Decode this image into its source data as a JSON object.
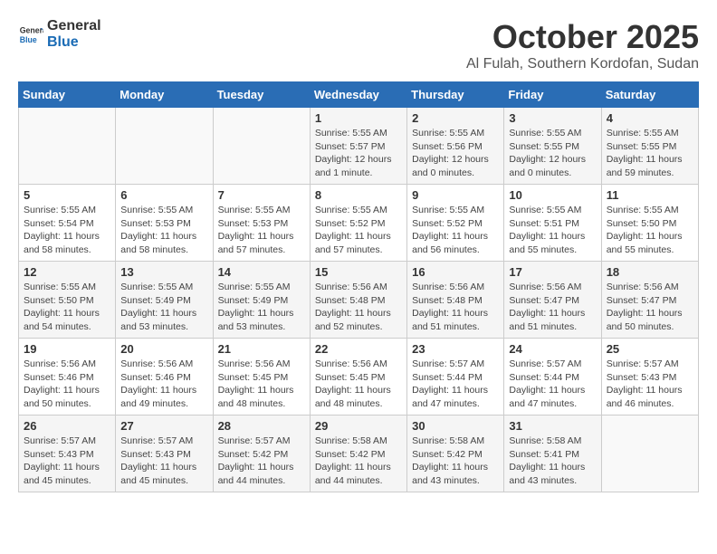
{
  "logo": {
    "general": "General",
    "blue": "Blue"
  },
  "title": "October 2025",
  "location": "Al Fulah, Southern Kordofan, Sudan",
  "weekdays": [
    "Sunday",
    "Monday",
    "Tuesday",
    "Wednesday",
    "Thursday",
    "Friday",
    "Saturday"
  ],
  "weeks": [
    [
      {
        "day": "",
        "info": ""
      },
      {
        "day": "",
        "info": ""
      },
      {
        "day": "",
        "info": ""
      },
      {
        "day": "1",
        "info": "Sunrise: 5:55 AM\nSunset: 5:57 PM\nDaylight: 12 hours\nand 1 minute."
      },
      {
        "day": "2",
        "info": "Sunrise: 5:55 AM\nSunset: 5:56 PM\nDaylight: 12 hours\nand 0 minutes."
      },
      {
        "day": "3",
        "info": "Sunrise: 5:55 AM\nSunset: 5:55 PM\nDaylight: 12 hours\nand 0 minutes."
      },
      {
        "day": "4",
        "info": "Sunrise: 5:55 AM\nSunset: 5:55 PM\nDaylight: 11 hours\nand 59 minutes."
      }
    ],
    [
      {
        "day": "5",
        "info": "Sunrise: 5:55 AM\nSunset: 5:54 PM\nDaylight: 11 hours\nand 58 minutes."
      },
      {
        "day": "6",
        "info": "Sunrise: 5:55 AM\nSunset: 5:53 PM\nDaylight: 11 hours\nand 58 minutes."
      },
      {
        "day": "7",
        "info": "Sunrise: 5:55 AM\nSunset: 5:53 PM\nDaylight: 11 hours\nand 57 minutes."
      },
      {
        "day": "8",
        "info": "Sunrise: 5:55 AM\nSunset: 5:52 PM\nDaylight: 11 hours\nand 57 minutes."
      },
      {
        "day": "9",
        "info": "Sunrise: 5:55 AM\nSunset: 5:52 PM\nDaylight: 11 hours\nand 56 minutes."
      },
      {
        "day": "10",
        "info": "Sunrise: 5:55 AM\nSunset: 5:51 PM\nDaylight: 11 hours\nand 55 minutes."
      },
      {
        "day": "11",
        "info": "Sunrise: 5:55 AM\nSunset: 5:50 PM\nDaylight: 11 hours\nand 55 minutes."
      }
    ],
    [
      {
        "day": "12",
        "info": "Sunrise: 5:55 AM\nSunset: 5:50 PM\nDaylight: 11 hours\nand 54 minutes."
      },
      {
        "day": "13",
        "info": "Sunrise: 5:55 AM\nSunset: 5:49 PM\nDaylight: 11 hours\nand 53 minutes."
      },
      {
        "day": "14",
        "info": "Sunrise: 5:55 AM\nSunset: 5:49 PM\nDaylight: 11 hours\nand 53 minutes."
      },
      {
        "day": "15",
        "info": "Sunrise: 5:56 AM\nSunset: 5:48 PM\nDaylight: 11 hours\nand 52 minutes."
      },
      {
        "day": "16",
        "info": "Sunrise: 5:56 AM\nSunset: 5:48 PM\nDaylight: 11 hours\nand 51 minutes."
      },
      {
        "day": "17",
        "info": "Sunrise: 5:56 AM\nSunset: 5:47 PM\nDaylight: 11 hours\nand 51 minutes."
      },
      {
        "day": "18",
        "info": "Sunrise: 5:56 AM\nSunset: 5:47 PM\nDaylight: 11 hours\nand 50 minutes."
      }
    ],
    [
      {
        "day": "19",
        "info": "Sunrise: 5:56 AM\nSunset: 5:46 PM\nDaylight: 11 hours\nand 50 minutes."
      },
      {
        "day": "20",
        "info": "Sunrise: 5:56 AM\nSunset: 5:46 PM\nDaylight: 11 hours\nand 49 minutes."
      },
      {
        "day": "21",
        "info": "Sunrise: 5:56 AM\nSunset: 5:45 PM\nDaylight: 11 hours\nand 48 minutes."
      },
      {
        "day": "22",
        "info": "Sunrise: 5:56 AM\nSunset: 5:45 PM\nDaylight: 11 hours\nand 48 minutes."
      },
      {
        "day": "23",
        "info": "Sunrise: 5:57 AM\nSunset: 5:44 PM\nDaylight: 11 hours\nand 47 minutes."
      },
      {
        "day": "24",
        "info": "Sunrise: 5:57 AM\nSunset: 5:44 PM\nDaylight: 11 hours\nand 47 minutes."
      },
      {
        "day": "25",
        "info": "Sunrise: 5:57 AM\nSunset: 5:43 PM\nDaylight: 11 hours\nand 46 minutes."
      }
    ],
    [
      {
        "day": "26",
        "info": "Sunrise: 5:57 AM\nSunset: 5:43 PM\nDaylight: 11 hours\nand 45 minutes."
      },
      {
        "day": "27",
        "info": "Sunrise: 5:57 AM\nSunset: 5:43 PM\nDaylight: 11 hours\nand 45 minutes."
      },
      {
        "day": "28",
        "info": "Sunrise: 5:57 AM\nSunset: 5:42 PM\nDaylight: 11 hours\nand 44 minutes."
      },
      {
        "day": "29",
        "info": "Sunrise: 5:58 AM\nSunset: 5:42 PM\nDaylight: 11 hours\nand 44 minutes."
      },
      {
        "day": "30",
        "info": "Sunrise: 5:58 AM\nSunset: 5:42 PM\nDaylight: 11 hours\nand 43 minutes."
      },
      {
        "day": "31",
        "info": "Sunrise: 5:58 AM\nSunset: 5:41 PM\nDaylight: 11 hours\nand 43 minutes."
      },
      {
        "day": "",
        "info": ""
      }
    ]
  ]
}
